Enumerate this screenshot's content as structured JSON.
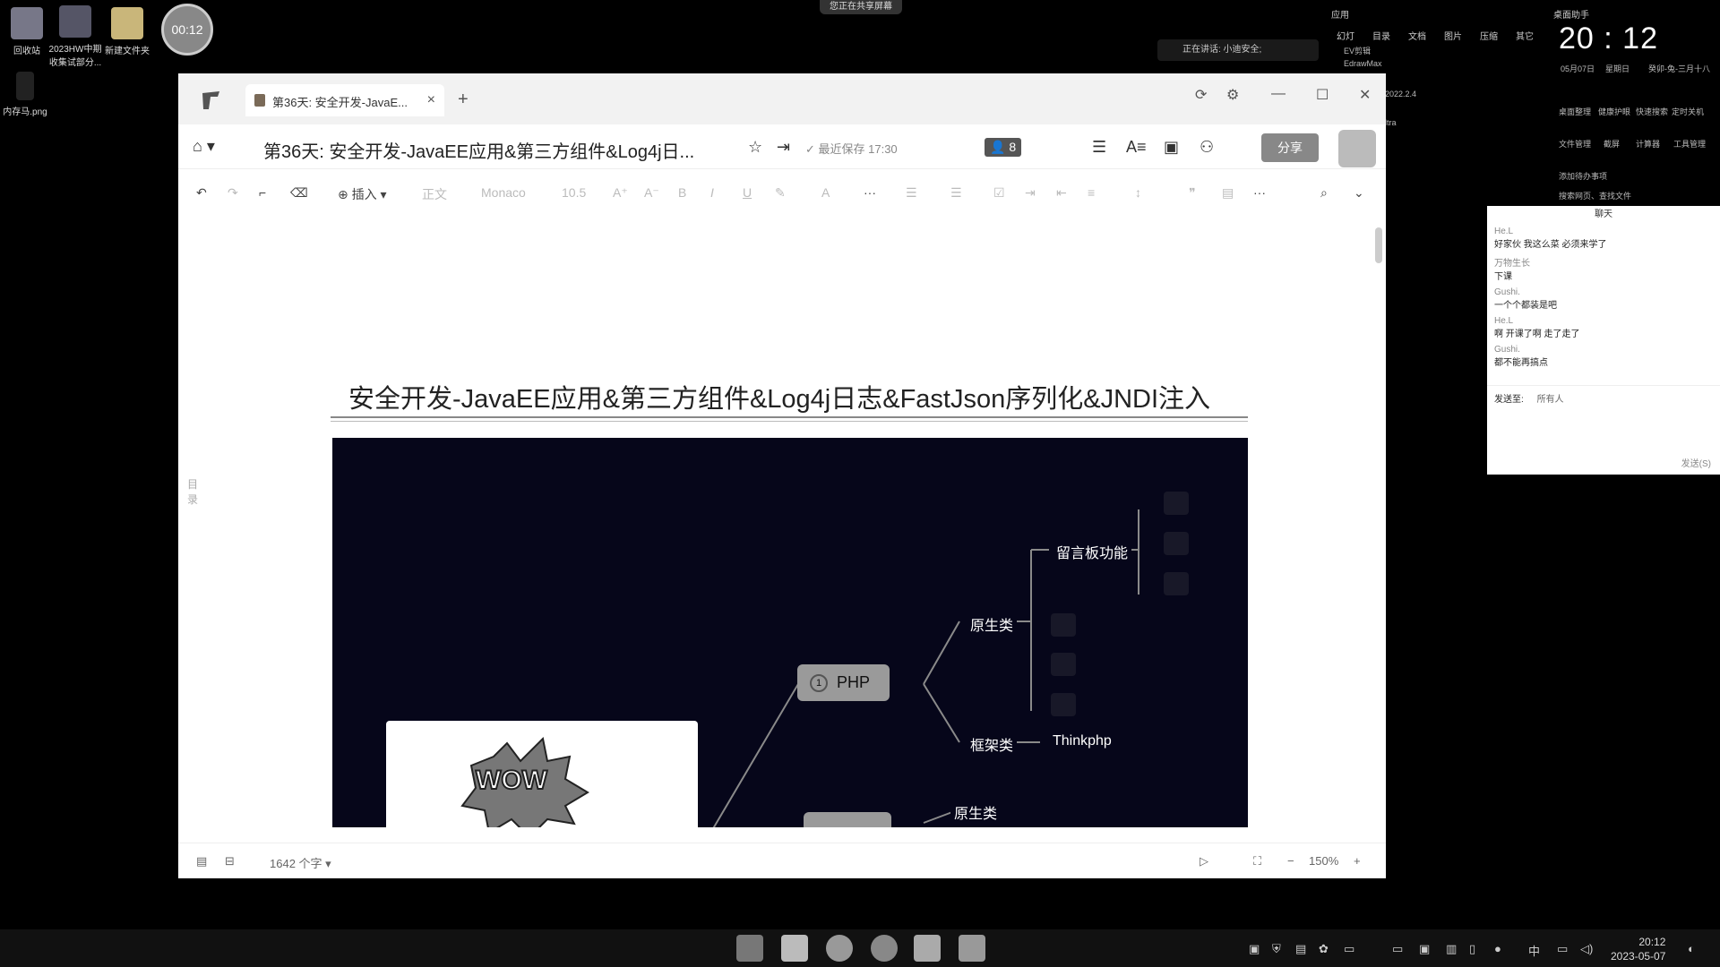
{
  "desktop": {
    "icons": [
      {
        "label": "回收站"
      },
      {
        "label": "2023HW中期\n收集试部分..."
      },
      {
        "label": "新建文件夹"
      },
      {
        "label": "内存马.png"
      }
    ],
    "timer": "00:12",
    "share_banner": "您正在共享屏幕"
  },
  "top_panel": {
    "section": "应用",
    "menu": [
      "幻灯",
      "目录",
      "文档",
      "图片",
      "压缩",
      "其它"
    ],
    "assistant": "桌面助手",
    "clock": "20 : 12",
    "date": "05月07日",
    "weekday": "星期日",
    "lunar": "癸卯-兔-三月十八",
    "speaking": "正在讲话: 小迪安全;",
    "apps": [
      "EV剪辑",
      "EdrawMax"
    ],
    "version": "2022.2.4",
    "edition": "ltra",
    "shortcuts": [
      "桌面整理",
      "健康护眼",
      "快速搜索",
      "定时关机",
      "文件管理",
      "截屏",
      "计算器",
      "工具管理"
    ],
    "add_todo": "添加待办事项",
    "search_web": "搜索网页、查找文件"
  },
  "chat": {
    "title": "聊天",
    "messages": [
      {
        "name": "He.L",
        "text": "好家伙 我这么菜 必须来学了"
      },
      {
        "name": "万物生长",
        "text": "下课"
      },
      {
        "name": "Gushi.",
        "text": "一个个都装是吧"
      },
      {
        "name": "He.L",
        "text": "啊 开课了啊 走了走了"
      },
      {
        "name": "Gushi.",
        "text": "都不能再搞点"
      }
    ],
    "send_to_label": "发送至:",
    "send_to_value": "所有人",
    "send_button": "发送(S)"
  },
  "app": {
    "tab_title": "第36天: 安全开发-JavaE...",
    "doc_title": "第36天: 安全开发-JavaEE应用&第三方组件&Log4j日...",
    "saved_status": "最近保存 17:30",
    "share_button": "分享",
    "collab_count": "8",
    "toolbar": {
      "insert": "插入",
      "style": "正文",
      "font": "Monaco",
      "size": "10.5"
    },
    "toc_label": "目录",
    "heading": "安全开发-JavaEE应用&第三方组件&Log4j日志&FastJson序列化&JNDI注入",
    "mindmap": {
      "main_node_1": "PHP",
      "main_node_1_index": "1",
      "native": "原生类",
      "board": "留言板功能",
      "framework": "框架类",
      "thinkphp": "Thinkphp",
      "native_2": "原生类",
      "wow": "WOW"
    },
    "word_count": "1642 个字",
    "zoom": "150%"
  },
  "taskbar": {
    "time": "20:12",
    "date": "2023-05-07",
    "ime": "中"
  }
}
